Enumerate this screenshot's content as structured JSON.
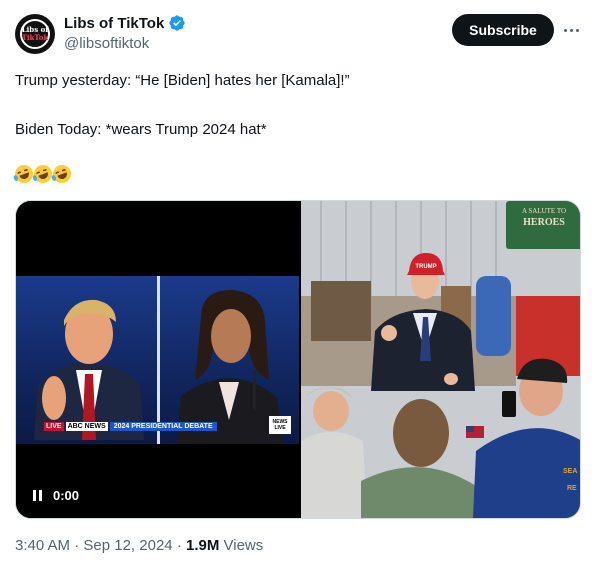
{
  "author": {
    "display_name": "Libs of TikTok",
    "handle": "@libsoftiktok",
    "avatar_text_line1": "Libs of",
    "avatar_text_line2": "TikTok",
    "verified_color": "#1d9bf0"
  },
  "actions": {
    "subscribe_label": "Subscribe",
    "more_icon": "more-horizontal-icon"
  },
  "tweet": {
    "line1": "Trump yesterday: “He [Biden] hates her [Kamala]!”",
    "line2": "Biden Today: *wears Trump 2024 hat*",
    "emoji": [
      "rolling-on-floor-laughing",
      "rolling-on-floor-laughing",
      "rolling-on-floor-laughing"
    ]
  },
  "media": {
    "video": {
      "chyron_live": "LIVE",
      "chyron_network": "ABC NEWS",
      "chyron_title": "2024 PRESIDENTIAL DEBATE",
      "corner_badge": "NEWS LIVE",
      "time": "0:00",
      "pause_icon": "pause-icon"
    },
    "photo": {
      "sign_text": "A SALUTE TO HEROES",
      "hat_text": "TRUMP",
      "shirt_text": "SEA RE"
    }
  },
  "meta": {
    "time": "3:40 AM",
    "separator": "·",
    "date": "Sep 12, 2024",
    "views_count": "1.9M",
    "views_label": "Views"
  }
}
